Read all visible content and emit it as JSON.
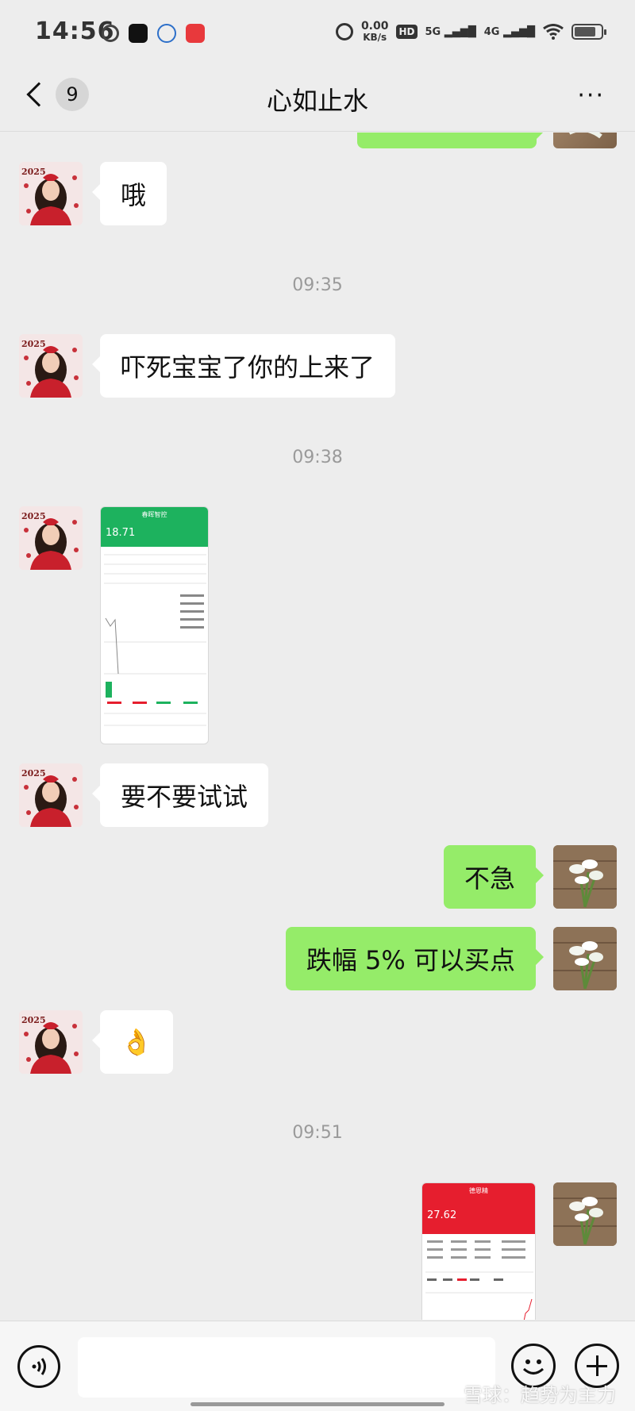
{
  "status_bar": {
    "time": "14:56",
    "net_speed_value": "0.00",
    "net_speed_unit": "KB/s",
    "hd_label": "HD",
    "sim1": "5G",
    "sim2": "4G"
  },
  "header": {
    "unread_count": "9",
    "title": "心如止水",
    "more_label": "···"
  },
  "messages": [
    {
      "type": "text",
      "from": "contact",
      "text": "哦"
    },
    {
      "type": "timestamp",
      "text": "09:35"
    },
    {
      "type": "text",
      "from": "contact",
      "text": "吓死宝宝了你的上来了"
    },
    {
      "type": "timestamp",
      "text": "09:38"
    },
    {
      "type": "image",
      "from": "contact",
      "price": "18.71",
      "stock": "春晖智控",
      "theme": "green"
    },
    {
      "type": "text",
      "from": "contact",
      "text": "要不要试试"
    },
    {
      "type": "text",
      "from": "me",
      "text": "不急"
    },
    {
      "type": "text",
      "from": "me",
      "text": "跌幅 5% 可以买点"
    },
    {
      "type": "text",
      "from": "contact",
      "text": "👌"
    },
    {
      "type": "timestamp",
      "text": "09:51"
    },
    {
      "type": "image",
      "from": "me",
      "price": "27.62",
      "stock": "德恩精",
      "theme": "red"
    }
  ],
  "avatar_contact": {
    "year": "2025"
  },
  "watermark": "雪球：趋势为主力",
  "colors": {
    "bubble_out": "#95ec69",
    "bubble_in": "#ffffff",
    "background": "#ededed",
    "stock_green": "#1db25e",
    "stock_red": "#e61e2e"
  }
}
